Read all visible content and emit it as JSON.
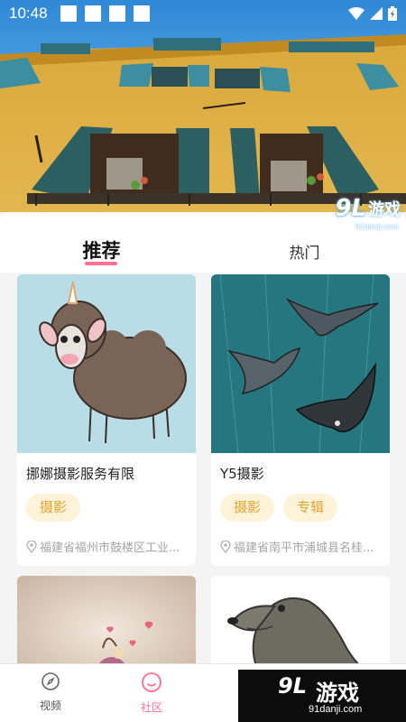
{
  "status_bar": {
    "time": "10:48"
  },
  "watermark_top": {
    "logo": "9L",
    "text": "游戏",
    "sub": "91danji.com"
  },
  "tabs": [
    {
      "label": "推荐",
      "active": true
    },
    {
      "label": "热门",
      "active": false
    }
  ],
  "cards": [
    {
      "title": "挪娜摄影服务有限",
      "tags": [
        "摄影"
      ],
      "address": "福建省福州市鼓楼区工业...",
      "image": "sheep-illustration"
    },
    {
      "title": "Y5摄影",
      "tags": [
        "摄影",
        "专辑"
      ],
      "address": "福建省南平市浦城县名桂...",
      "image": "manta-ray-illustration"
    },
    {
      "title": "",
      "tags": [],
      "address": "",
      "image": "snail-hearts-illustration"
    },
    {
      "title": "",
      "tags": [],
      "address": "",
      "image": "seal-illustration"
    }
  ],
  "bottom_nav": [
    {
      "label": "视频",
      "icon": "compass-icon",
      "active": false
    },
    {
      "label": "社区",
      "icon": "smiley-icon",
      "active": true
    }
  ],
  "watermark_bottom": {
    "logo": "9L",
    "text": "游戏",
    "sub": "91danji.com"
  },
  "colors": {
    "accent": "#ff6f8f",
    "tag_bg": "#fdf3d9",
    "tag_text": "#e3a431"
  }
}
